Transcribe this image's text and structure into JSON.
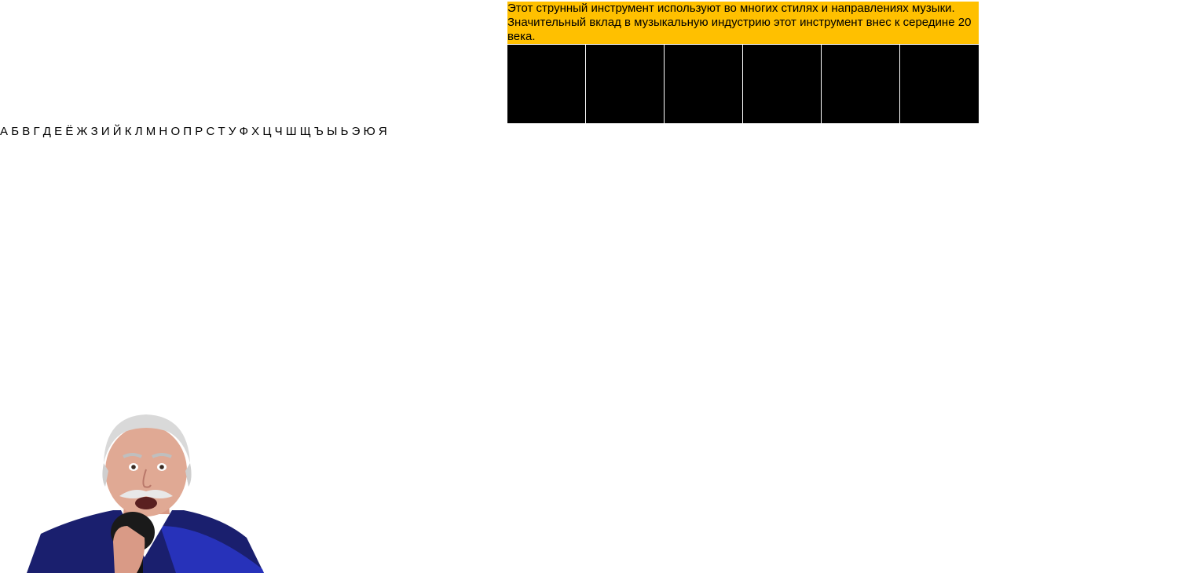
{
  "question": {
    "text": "Этот струнный инструмент используют во многих стилях и направлениях музыки. Значительный вклад в музыкальную индустрию этот инструмент внес к середине 20 века."
  },
  "word": {
    "cells": [
      "",
      "",
      "",
      "",
      "",
      ""
    ]
  },
  "alphabet": {
    "letters": [
      "А",
      "Б",
      "В",
      "Г",
      "Д",
      "Е",
      "Ё",
      "Ж",
      "З",
      "И",
      "Й",
      "К",
      "Л",
      "М",
      "Н",
      "О",
      "П",
      "Р",
      "С",
      "Т",
      "У",
      "Ф",
      "Х",
      "Ц",
      "Ч",
      "Ш",
      "Щ",
      "Ъ",
      "Ы",
      "Ь",
      "Э",
      "Ю",
      "Я"
    ]
  },
  "host": {
    "icon": "host-with-microphone"
  },
  "colors": {
    "clue_background": "#ffc000",
    "cell_background": "#000000",
    "page_background": "#ffffff"
  }
}
